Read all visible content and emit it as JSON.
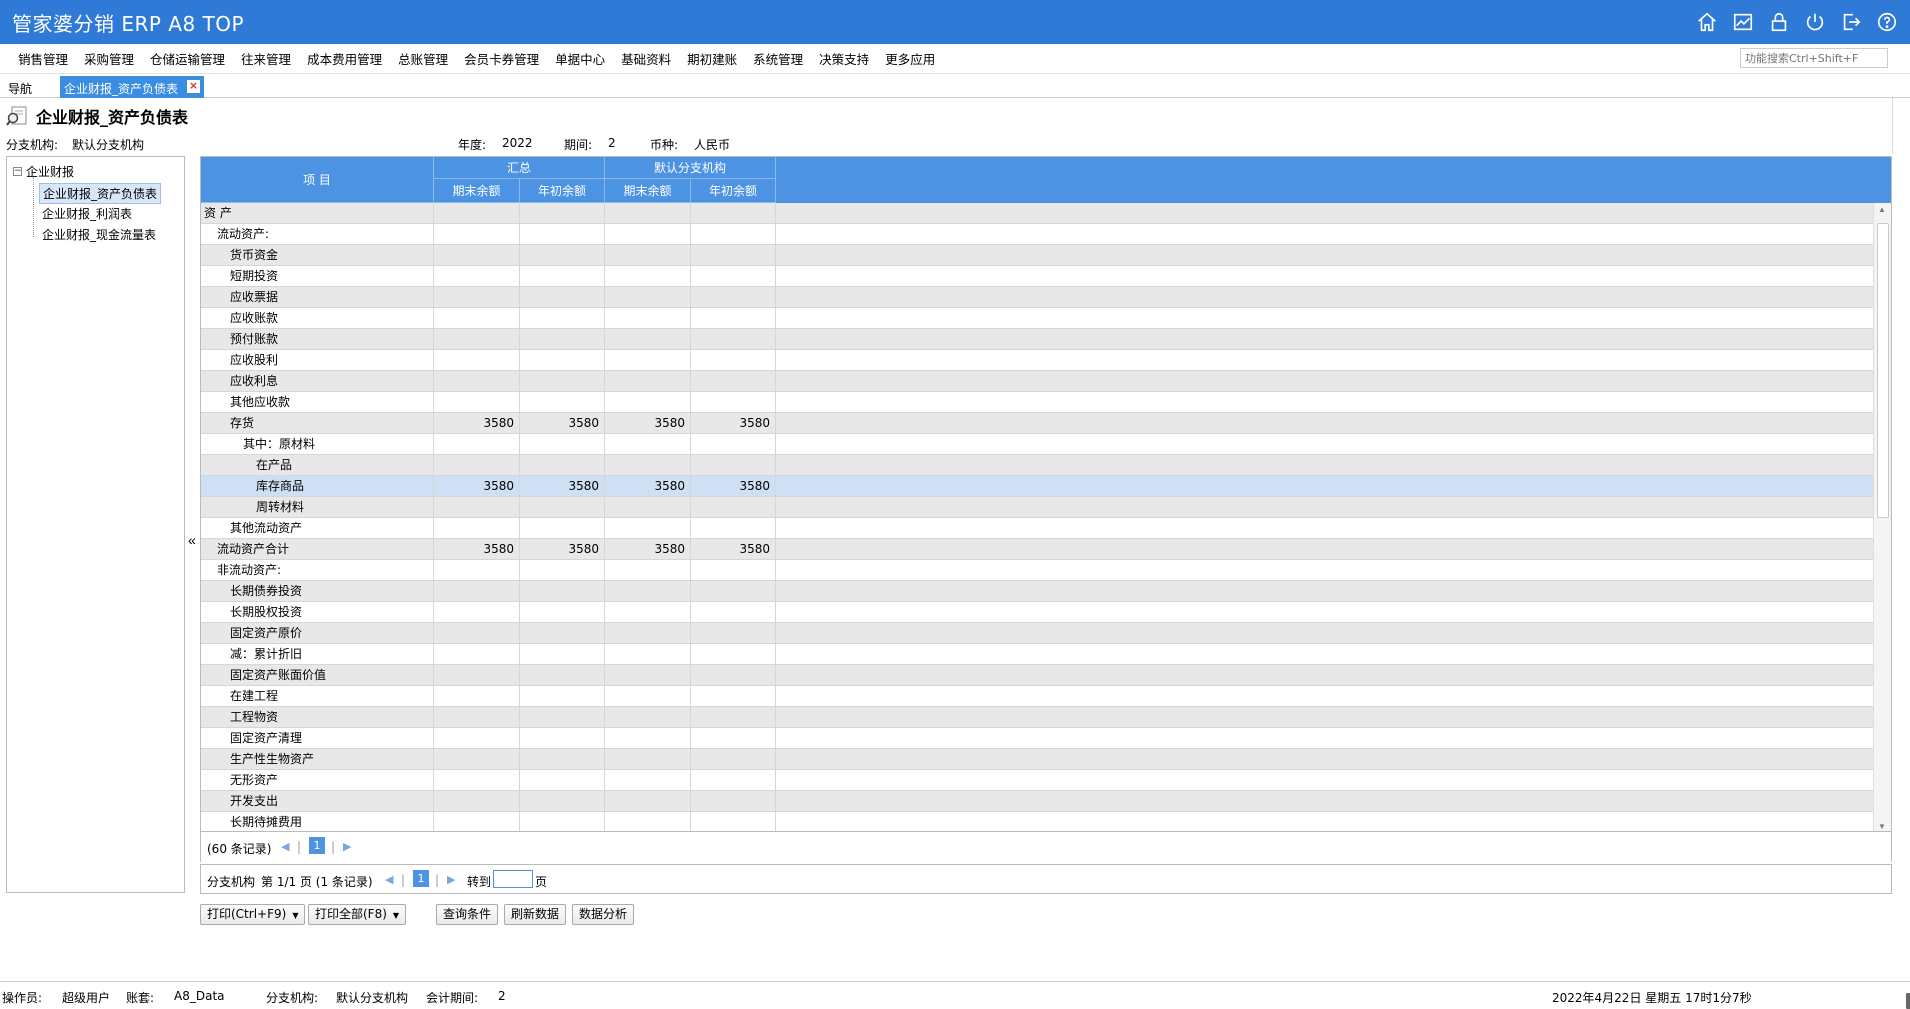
{
  "app": {
    "title": "管家婆分销 ERP A8 TOP"
  },
  "top_icons": [
    "home-icon",
    "chart-icon",
    "lock-icon",
    "power-icon",
    "exit-icon",
    "help-icon"
  ],
  "menu": [
    "销售管理",
    "采购管理",
    "仓储运输管理",
    "往来管理",
    "成本费用管理",
    "总账管理",
    "会员卡券管理",
    "单据中心",
    "基础资料",
    "期初建账",
    "系统管理",
    "决策支持",
    "更多应用"
  ],
  "search": {
    "placeholder": "功能搜索Ctrl+Shift+F"
  },
  "tabs": {
    "nav": "导航",
    "active": "企业财报_资产负债表"
  },
  "page": {
    "title": "企业财报_资产负债表"
  },
  "filters": {
    "branch_label": "分支机构:",
    "branch_value": "默认分支机构",
    "year_label": "年度:",
    "year_value": "2022",
    "period_label": "期间:",
    "period_value": "2",
    "currency_label": "币种:",
    "currency_value": "人民币"
  },
  "tree": {
    "root": "企业财报",
    "items": [
      "企业财报_资产负债表",
      "企业财报_利润表",
      "企业财报_现金流量表"
    ]
  },
  "grid": {
    "col_item": "项 目",
    "group1": "汇总",
    "group2": "默认分支机构",
    "sub_cols": [
      "期末余额",
      "年初余额",
      "期末余额",
      "年初余额"
    ],
    "rows": [
      {
        "name": "资 产",
        "indent": 0,
        "v": [
          "",
          "",
          "",
          ""
        ]
      },
      {
        "name": "流动资产:",
        "indent": 1,
        "v": [
          "",
          "",
          "",
          ""
        ]
      },
      {
        "name": "货币资金",
        "indent": 2,
        "v": [
          "",
          "",
          "",
          ""
        ]
      },
      {
        "name": "短期投资",
        "indent": 2,
        "v": [
          "",
          "",
          "",
          ""
        ]
      },
      {
        "name": "应收票据",
        "indent": 2,
        "v": [
          "",
          "",
          "",
          ""
        ]
      },
      {
        "name": "应收账款",
        "indent": 2,
        "v": [
          "",
          "",
          "",
          ""
        ]
      },
      {
        "name": "预付账款",
        "indent": 2,
        "v": [
          "",
          "",
          "",
          ""
        ]
      },
      {
        "name": "应收股利",
        "indent": 2,
        "v": [
          "",
          "",
          "",
          ""
        ]
      },
      {
        "name": "应收利息",
        "indent": 2,
        "v": [
          "",
          "",
          "",
          ""
        ]
      },
      {
        "name": "其他应收款",
        "indent": 2,
        "v": [
          "",
          "",
          "",
          ""
        ]
      },
      {
        "name": "存货",
        "indent": 2,
        "v": [
          "3580",
          "3580",
          "3580",
          "3580"
        ]
      },
      {
        "name": "其中：原材料",
        "indent": 3,
        "v": [
          "",
          "",
          "",
          ""
        ]
      },
      {
        "name": "在产品",
        "indent": 4,
        "v": [
          "",
          "",
          "",
          ""
        ]
      },
      {
        "name": "库存商品",
        "indent": 4,
        "v": [
          "3580",
          "3580",
          "3580",
          "3580"
        ],
        "hl": true
      },
      {
        "name": "周转材料",
        "indent": 4,
        "v": [
          "",
          "",
          "",
          ""
        ]
      },
      {
        "name": "其他流动资产",
        "indent": 2,
        "v": [
          "",
          "",
          "",
          ""
        ]
      },
      {
        "name": "流动资产合计",
        "indent": 1,
        "v": [
          "3580",
          "3580",
          "3580",
          "3580"
        ]
      },
      {
        "name": "非流动资产:",
        "indent": 1,
        "v": [
          "",
          "",
          "",
          ""
        ]
      },
      {
        "name": "长期债券投资",
        "indent": 2,
        "v": [
          "",
          "",
          "",
          ""
        ]
      },
      {
        "name": "长期股权投资",
        "indent": 2,
        "v": [
          "",
          "",
          "",
          ""
        ]
      },
      {
        "name": "固定资产原价",
        "indent": 2,
        "v": [
          "",
          "",
          "",
          ""
        ]
      },
      {
        "name": "减：累计折旧",
        "indent": 2,
        "v": [
          "",
          "",
          "",
          ""
        ]
      },
      {
        "name": "固定资产账面价值",
        "indent": 2,
        "v": [
          "",
          "",
          "",
          ""
        ]
      },
      {
        "name": "在建工程",
        "indent": 2,
        "v": [
          "",
          "",
          "",
          ""
        ]
      },
      {
        "name": "工程物资",
        "indent": 2,
        "v": [
          "",
          "",
          "",
          ""
        ]
      },
      {
        "name": "固定资产清理",
        "indent": 2,
        "v": [
          "",
          "",
          "",
          ""
        ]
      },
      {
        "name": "生产性生物资产",
        "indent": 2,
        "v": [
          "",
          "",
          "",
          ""
        ]
      },
      {
        "name": "无形资产",
        "indent": 2,
        "v": [
          "",
          "",
          "",
          ""
        ]
      },
      {
        "name": "开发支出",
        "indent": 2,
        "v": [
          "",
          "",
          "",
          ""
        ]
      },
      {
        "name": "长期待摊费用",
        "indent": 2,
        "v": [
          "",
          "",
          "",
          ""
        ]
      }
    ]
  },
  "pager1": {
    "records": "(60 条记录)",
    "page": "1"
  },
  "pager2": {
    "label": "分支机构",
    "info": "第  1/1 页 (1 条记录)",
    "page": "1",
    "goto_label": "转到",
    "goto_suffix": "页"
  },
  "buttons": {
    "print": "打印(Ctrl+F9)",
    "print_all": "打印全部(F8)",
    "query": "查询条件",
    "refresh": "刷新数据",
    "analyze": "数据分析"
  },
  "status": {
    "operator_label": "操作员:",
    "operator": "超级用户",
    "account_label": "账套:",
    "account": "A8_Data",
    "branch_label": "分支机构:",
    "branch": "默认分支机构",
    "period_label": "会计期间:",
    "period": "2",
    "datetime": "2022年4月22日  星期五   17时1分7秒"
  }
}
